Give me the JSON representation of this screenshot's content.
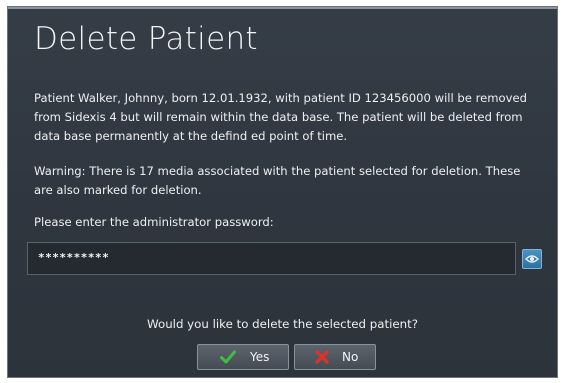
{
  "dialog": {
    "title": "Delete Patient",
    "message": "Patient Walker, Johnny, born 12.01.1932, with patient ID 123456000 will be removed from Sidexis 4 but will remain within the data base. The patient will be deleted from data base permanently at the defind ed point of time.",
    "warning": "Warning: There is 17 media associated with the patient selected for deletion. These are also marked for deletion.",
    "password_label": "Please enter the administrator password:",
    "password_value": "**********",
    "reveal_icon": "eye-icon",
    "question": "Would you like to delete the selected patient?",
    "yes_label": "Yes",
    "no_label": "No",
    "yes_icon": "checkmark-icon",
    "no_icon": "cross-icon"
  },
  "colors": {
    "dialog_bg": "#323a43",
    "field_bg": "#252a30",
    "reveal_accent": "#3b82b4",
    "check_green": "#3fbf3f",
    "cross_red": "#d9342b"
  }
}
